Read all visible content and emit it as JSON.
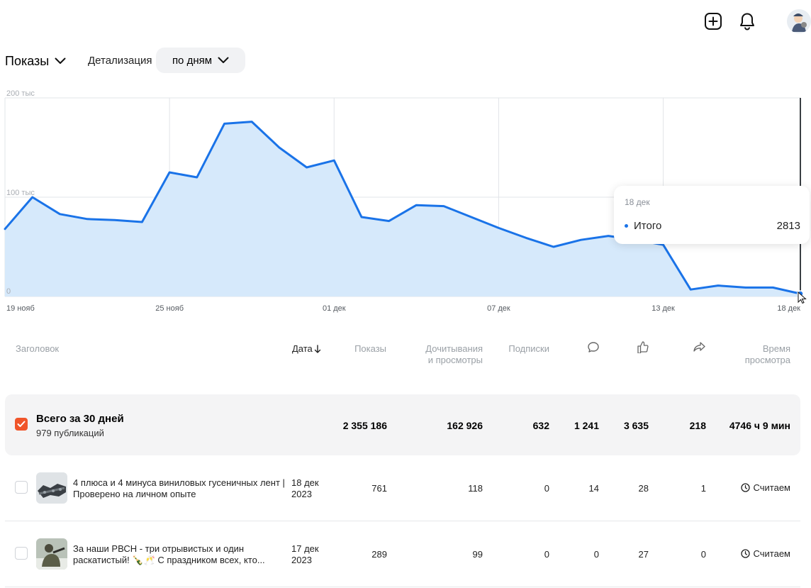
{
  "header": {
    "icons": [
      "plus-square-icon",
      "bell-icon",
      "avatar"
    ]
  },
  "controls": {
    "metric": "Показы",
    "detail_label": "Детализация",
    "detail_value": "по дням"
  },
  "chart_data": {
    "type": "area",
    "y_ticks": [
      "200 тыс",
      "100 тыс",
      "0"
    ],
    "x_ticks": [
      "19 нояб",
      "25 нояб",
      "01 дек",
      "07 дек",
      "13 дек",
      "18 дек"
    ],
    "ylim": [
      0,
      200000
    ],
    "x": [
      "19 нояб",
      "20 нояб",
      "21 нояб",
      "22 нояб",
      "23 нояб",
      "24 нояб",
      "25 нояб",
      "26 нояб",
      "27 нояб",
      "28 нояб",
      "29 нояб",
      "30 нояб",
      "01 дек",
      "02 дек",
      "03 дек",
      "04 дек",
      "05 дек",
      "06 дек",
      "07 дек",
      "08 дек",
      "09 дек",
      "10 дек",
      "11 дек",
      "12 дек",
      "13 дек",
      "14 дек",
      "15 дек",
      "16 дек",
      "17 дек",
      "18 дек"
    ],
    "values": [
      68000,
      100000,
      83000,
      78000,
      77000,
      75000,
      125000,
      120000,
      174000,
      176000,
      150000,
      130000,
      137000,
      80000,
      76000,
      92000,
      91000,
      80000,
      69000,
      59000,
      50000,
      57000,
      61000,
      57000,
      52000,
      7000,
      11000,
      9000,
      9000,
      2813
    ],
    "grid": true,
    "color": "#1a73e8",
    "fill": "#d6e9fb"
  },
  "tooltip": {
    "date": "18 дек",
    "label": "Итого",
    "value": "2813"
  },
  "table": {
    "headers": {
      "title": "Заголовок",
      "date": "Дата",
      "impressions": "Показы",
      "reads_1": "Дочитывания",
      "reads_2": "и просмотры",
      "subs": "Подписки",
      "time_1": "Время",
      "time_2": "просмотра"
    },
    "summary": {
      "title": "Всего за 30 дней",
      "sub": "979 публикаций",
      "impressions": "2 355 186",
      "reads": "162 926",
      "subs": "632",
      "comments": "1 241",
      "likes": "3 635",
      "shares": "218",
      "time": "4746 ч 9 мин"
    },
    "rows": [
      {
        "title_1": "4 плюса и 4 минуса виниловых гусеничных лент |",
        "title_2": "Проверено на личном опыте",
        "date_1": "18 дек",
        "date_2": "2023",
        "impressions": "761",
        "reads": "118",
        "subs": "0",
        "comments": "14",
        "likes": "28",
        "shares": "1",
        "time": "Считаем"
      },
      {
        "title_1": "За наши РВСН - три отрывистых и один",
        "title_2": "раскатистый! 🍾🥂 С праздником всех, кто...",
        "date_1": "17 дек",
        "date_2": "2023",
        "impressions": "289",
        "reads": "99",
        "subs": "0",
        "comments": "0",
        "likes": "27",
        "shares": "0",
        "time": "Считаем"
      }
    ]
  }
}
